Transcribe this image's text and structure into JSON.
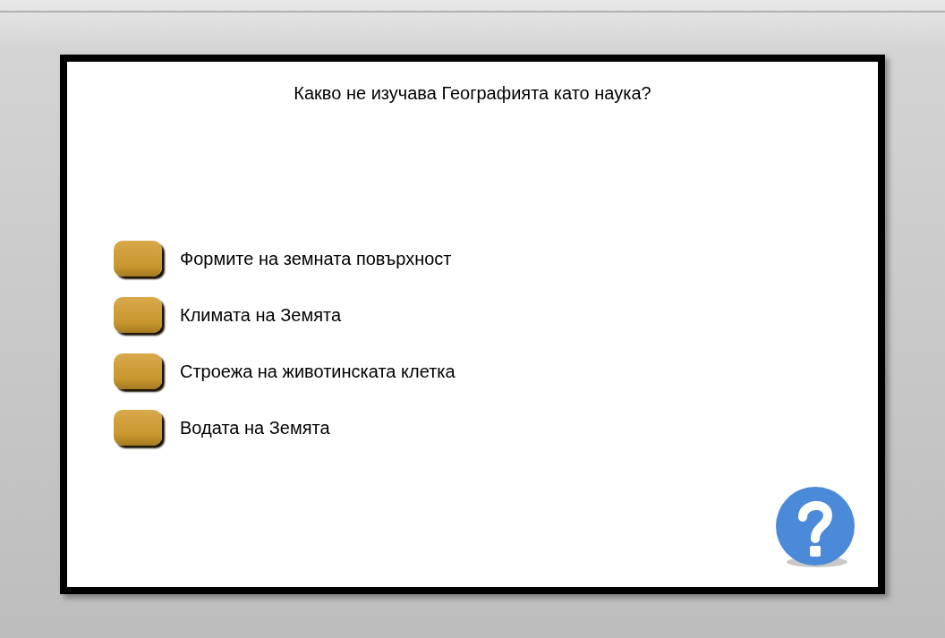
{
  "question": "Какво не изучава Географията като наука?",
  "options": [
    {
      "label": "Формите на земната повърхност"
    },
    {
      "label": "Климата на Земята"
    },
    {
      "label": "Строежа на животинската клетка"
    },
    {
      "label": "Водата на Земята"
    }
  ]
}
